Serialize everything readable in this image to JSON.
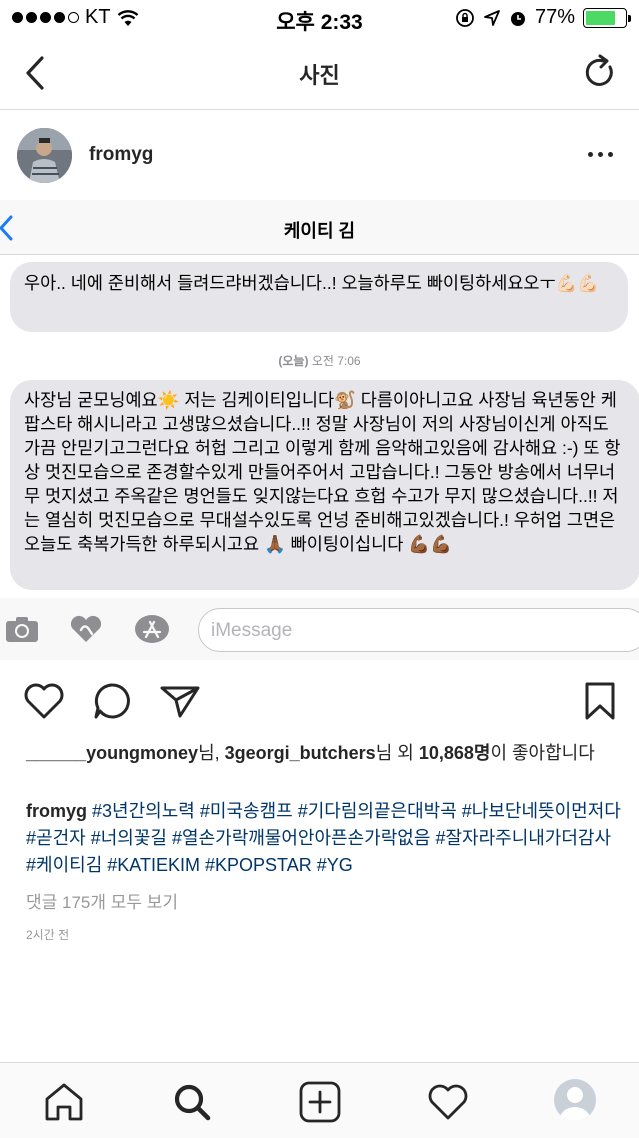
{
  "status_bar": {
    "carrier": "KT",
    "time": "오후 2:33",
    "battery_percent": "77%",
    "battery_level": 0.77,
    "icons": [
      "signal-dots-icon",
      "wifi-icon",
      "orientation-lock-icon",
      "location-icon",
      "alarm-icon",
      "battery-icon"
    ]
  },
  "nav": {
    "title": "사진",
    "back_icon": "chevron-left-icon",
    "refresh_icon": "refresh-icon"
  },
  "post": {
    "username": "fromyg",
    "more_icon": "more-horizontal-icon"
  },
  "photo": {
    "contact_name": "케이티 김",
    "message1": "우아.. 네에 준비해서 들려드랴버겠습니다..! 오늘하루도 빠이팅하세요오ㅜ💪🏻💪🏻",
    "timestamp_day": "(오늘)",
    "timestamp_time": "오전 7:06",
    "message2": "사장님 굳모닝예요☀️ 저는 김케이티입니다🐒 다름이아니고요 사장님 육년동안 케팝스타 해시니라고 고생많으셨습니다..!! 정말 사장님이 저의 사장님이신게 아직도 가끔 안믿기고그런다요 허헙 그리고 이렇게 함께 음악해고있음에 감사해요 :-) 또 항상 멋진모습으로 존경할수있게 만들어주어서 고맙습니다.! 그동안 방송에서 너무너무 멋지셨고 주옥같은 명언들도 잊지않는다요 흐헙 수고가 무지 많으셨습니다..!! 저는 열심히 멋진모습으로 무대설수있도록 언넝 준비해고있겠습니다.! 우허업 그면은 오늘도 축복가득한 하루되시고요 🙏🏾 빠이팅이십니다 💪🏾💪🏾",
    "input_placeholder": "iMessage",
    "toolbar_icons": [
      "camera-icon",
      "digital-touch-heart-icon",
      "app-store-icon"
    ]
  },
  "actions": {
    "icons": [
      "heart-icon",
      "comment-icon",
      "share-icon",
      "bookmark-icon"
    ]
  },
  "likes": {
    "user1": "______youngmoney",
    "suffix1": "님, ",
    "user2": "3georgi_butchers",
    "suffix2": "님 외 ",
    "count": "10,868명",
    "suffix3": "이 좋아합니다"
  },
  "caption": {
    "username": "fromyg",
    "tags": [
      "#3년간의노력",
      "#미국송캠프",
      "#기다림의끝은대박곡",
      "#나보단네뜻이먼저다",
      "#곧건자",
      "#너의꽃길",
      "#열손가락깨물어안아픈손가락없음",
      "#잘자라주니내가더감사",
      "#케이티김",
      "#KATIEKIM",
      "#KPOPSTAR",
      "#YG"
    ]
  },
  "comments_link": "댓글 175개 모두 보기",
  "post_time": "2시간 전",
  "tabbar": {
    "icons": [
      "home-icon",
      "search-icon",
      "add-post-icon",
      "activity-heart-icon",
      "profile-icon"
    ]
  }
}
